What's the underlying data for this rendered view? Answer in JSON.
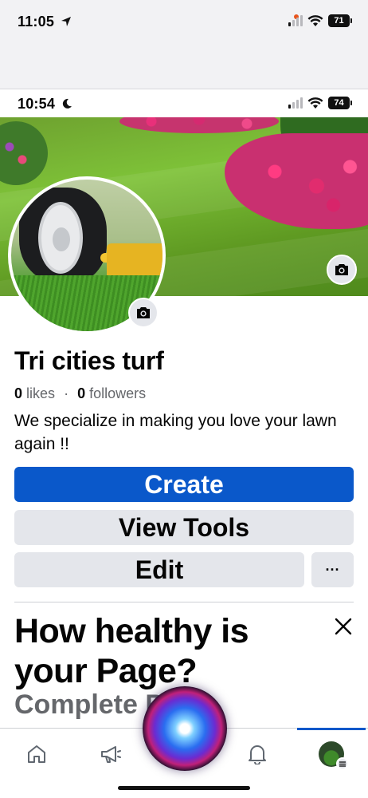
{
  "outer_status": {
    "time": "11:05",
    "battery": "71"
  },
  "inner_status": {
    "time": "10:54",
    "battery": "74"
  },
  "page": {
    "name": "Tri cities turf",
    "likes_count": "0",
    "likes_label": "likes",
    "separator": "·",
    "followers_count": "0",
    "followers_label": "followers",
    "bio": "We specialize in making you love your lawn again !!"
  },
  "actions": {
    "create": "Create",
    "view_tools": "View Tools",
    "edit": "Edit",
    "more": "···"
  },
  "health_card": {
    "title": "How healthy is your Page?",
    "subtitle": "Complete Page"
  },
  "bottom_nav": [
    "home-icon",
    "megaphone-icon",
    "bell-icon",
    "profile-avatar"
  ],
  "colors": {
    "primary": "#0a58ca",
    "secondary_button": "#e4e6eb",
    "muted_text": "#65676b"
  }
}
